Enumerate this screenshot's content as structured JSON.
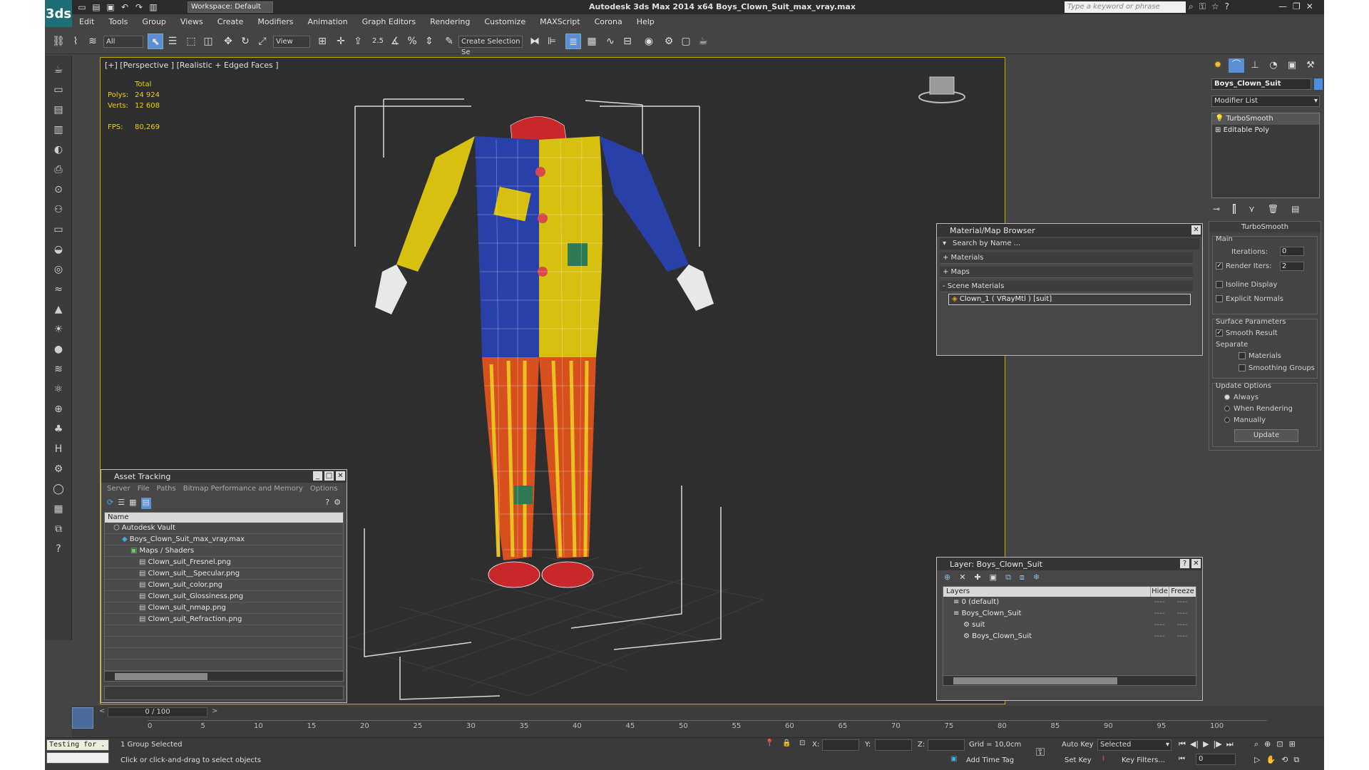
{
  "app": {
    "title": "Autodesk 3ds Max  2014 x64      Boys_Clown_Suit_max_vray.max",
    "logo": "3ds",
    "workspace": "Workspace: Default",
    "search_placeholder": "Type a keyword or phrase"
  },
  "menu": [
    "Edit",
    "Tools",
    "Group",
    "Views",
    "Create",
    "Modifiers",
    "Animation",
    "Graph Editors",
    "Rendering",
    "Customize",
    "MAXScript",
    "Corona",
    "Help"
  ],
  "toolbar": {
    "selection_filter": "All",
    "ref_coord": "View",
    "snap_label": "2.5",
    "selection_set": "Create Selection Se"
  },
  "viewport": {
    "label": "[+] [Perspective ] [Realistic + Edged Faces ]",
    "stats": {
      "header": "Total",
      "polys_label": "Polys:",
      "polys": "24 924",
      "verts_label": "Verts:",
      "verts": "12 608",
      "fps_label": "FPS:",
      "fps": "80,269"
    }
  },
  "asset_tracking": {
    "title": "Asset Tracking",
    "menu": [
      "Server",
      "File",
      "Paths",
      "Bitmap Performance and Memory",
      "Options"
    ],
    "column_name": "Name",
    "items": [
      {
        "label": "Autodesk Vault",
        "indent": 1
      },
      {
        "label": "Boys_Clown_Suit_max_vray.max",
        "indent": 2
      },
      {
        "label": "Maps / Shaders",
        "indent": 3
      },
      {
        "label": "Clown_suit_Fresnel.png",
        "indent": 4
      },
      {
        "label": "Clown_suit__Specular.png",
        "indent": 4
      },
      {
        "label": "Clown_suit_color.png",
        "indent": 4
      },
      {
        "label": "Clown_suit_Glossiness.png",
        "indent": 4
      },
      {
        "label": "Clown_suit_nmap.png",
        "indent": 4
      },
      {
        "label": "Clown_suit_Refraction.png",
        "indent": 4
      }
    ]
  },
  "material_browser": {
    "title": "Material/Map Browser",
    "search_placeholder": "Search by Name ...",
    "sections": [
      "+ Materials",
      "+ Maps",
      "- Scene Materials"
    ],
    "scene_material": "Clown_1  ( VRayMtl ) [suit]"
  },
  "layer_panel": {
    "title": "Layer: Boys_Clown_Suit",
    "col_layers": "Layers",
    "col_hide": "Hide",
    "col_freeze": "Freeze",
    "rows": [
      {
        "label": "0 (default)",
        "indent": 1
      },
      {
        "label": "Boys_Clown_Suit",
        "indent": 1
      },
      {
        "label": "suit",
        "indent": 2
      },
      {
        "label": "Boys_Clown_Suit",
        "indent": 2
      }
    ],
    "dash": "----"
  },
  "command_panel": {
    "object_name": "Boys_Clown_Suit",
    "modifier_list": "Modifier List",
    "stack": [
      "TurboSmooth",
      "Editable Poly"
    ],
    "turbosmooth_title": "TurboSmooth",
    "main_label": "Main",
    "iterations_label": "Iterations:",
    "iterations": "0",
    "render_iters_label": "Render Iters:",
    "render_iters": "2",
    "isoline": "Isoline Display",
    "explicit_normals": "Explicit Normals",
    "surface_params": "Surface Parameters",
    "smooth_result": "Smooth Result",
    "separate": "Separate",
    "materials": "Materials",
    "smoothing_groups": "Smoothing Groups",
    "update_options": "Update Options",
    "always": "Always",
    "when_rendering": "When Rendering",
    "manually": "Manually",
    "update_button": "Update"
  },
  "timeline": {
    "frame_display": "0 / 100",
    "ticks": [
      "0",
      "5",
      "10",
      "15",
      "20",
      "25",
      "30",
      "35",
      "40",
      "45",
      "50",
      "55",
      "60",
      "65",
      "70",
      "75",
      "80",
      "85",
      "90",
      "95",
      "100"
    ]
  },
  "status": {
    "script_text": "Testing for .",
    "selected": "1 Group Selected",
    "prompt": "Click or click-and-drag to select objects",
    "x_label": "X:",
    "y_label": "Y:",
    "z_label": "Z:",
    "grid": "Grid = 10,0cm",
    "add_time_tag": "Add Time Tag",
    "auto_key": "Auto Key",
    "set_key": "Set Key",
    "selected_dd": "Selected",
    "key_filters": "Key Filters...",
    "frame": "0"
  }
}
